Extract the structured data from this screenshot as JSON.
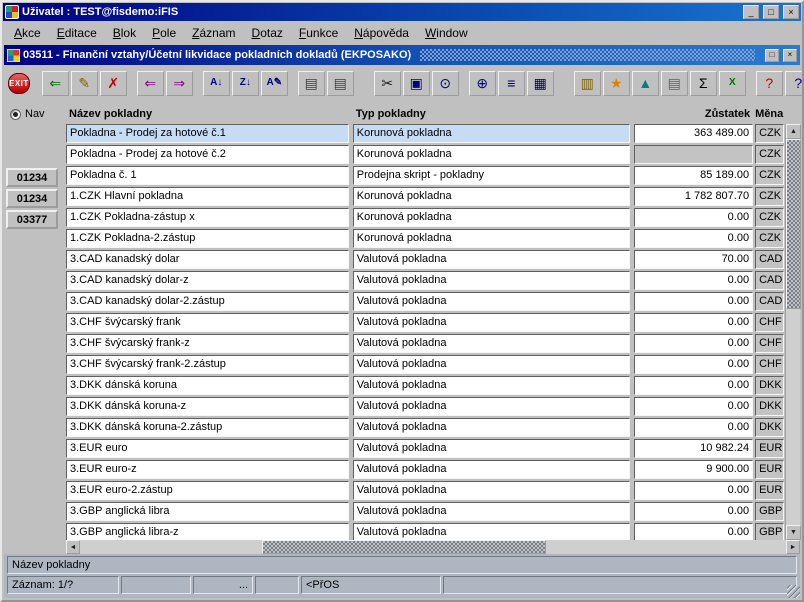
{
  "window": {
    "title": "Uživatel : TEST@fisdemo:iFIS",
    "buttons": {
      "minimize": "_",
      "maximize": "□",
      "close": "×"
    }
  },
  "menu": {
    "items": [
      "Akce",
      "Editace",
      "Blok",
      "Pole",
      "Záznam",
      "Dotaz",
      "Funkce",
      "Nápověda",
      "Window"
    ]
  },
  "mdi": {
    "title": "03511 - Finanční vztahy/Účetní likvidace pokladních dokladů (EKPOSAKO)",
    "buttons": {
      "restore": "□",
      "close": "×"
    }
  },
  "toolbar": {
    "exit_label": "EXIT",
    "icons": [
      {
        "name": "rollback-icon",
        "glyph": "⇐",
        "color": "#007000",
        "gap": ""
      },
      {
        "name": "edit-record-icon",
        "glyph": "✎",
        "color": "#806000",
        "gap": ""
      },
      {
        "name": "delete-record-icon",
        "glyph": "✗",
        "color": "#c00000",
        "gap": ""
      },
      {
        "name": "fetch-prev-icon",
        "glyph": "⇐",
        "color": "#800080",
        "gap": "gap"
      },
      {
        "name": "fetch-next-icon",
        "glyph": "⇒",
        "color": "#800080",
        "gap": ""
      },
      {
        "name": "sort-asc-icon",
        "glyph": "A↓",
        "color": "#000080",
        "gap": "gap",
        "small": true
      },
      {
        "name": "sort-desc-icon",
        "glyph": "Z↓",
        "color": "#000080",
        "gap": "",
        "small": true
      },
      {
        "name": "sort-edit-icon",
        "glyph": "A✎",
        "color": "#000080",
        "gap": "",
        "small": true
      },
      {
        "name": "print-icon",
        "glyph": "▤",
        "color": "#404040",
        "gap": "gap"
      },
      {
        "name": "print-all-icon",
        "glyph": "▤",
        "color": "#404040",
        "gap": ""
      },
      {
        "name": "cut-icon",
        "glyph": "✂",
        "color": "#202020",
        "gap": "biggap"
      },
      {
        "name": "copy-icon",
        "glyph": "▣",
        "color": "#000080",
        "gap": ""
      },
      {
        "name": "find-icon",
        "glyph": "⊙",
        "color": "#000080",
        "gap": ""
      },
      {
        "name": "zoom-icon",
        "glyph": "⊕",
        "color": "#000080",
        "gap": "gap"
      },
      {
        "name": "list-icon",
        "glyph": "≡",
        "color": "#000080",
        "gap": ""
      },
      {
        "name": "detail-list-icon",
        "glyph": "▦",
        "color": "#000080",
        "gap": ""
      },
      {
        "name": "clipboard-icon",
        "glyph": "▥",
        "color": "#806000",
        "gap": "biggap"
      },
      {
        "name": "favorites-icon",
        "glyph": "★",
        "color": "#e08000",
        "gap": ""
      },
      {
        "name": "chart-icon",
        "glyph": "▲",
        "color": "#008080",
        "gap": ""
      },
      {
        "name": "printer2-icon",
        "glyph": "▤",
        "color": "#606060",
        "gap": ""
      },
      {
        "name": "sum-icon",
        "glyph": "Σ",
        "color": "#000000",
        "gap": ""
      },
      {
        "name": "excel-icon",
        "glyph": "X",
        "color": "#007000",
        "gap": "",
        "small": true
      },
      {
        "name": "help-context-icon",
        "glyph": "?",
        "color": "#c00000",
        "gap": "gap"
      },
      {
        "name": "help-icon",
        "glyph": "?",
        "color": "#000080",
        "gap": ""
      }
    ]
  },
  "nav": {
    "label": "Nav",
    "buttons": [
      "01234",
      "01234",
      "03377"
    ]
  },
  "table": {
    "headers": {
      "name": "Název pokladny",
      "type": "Typ pokladny",
      "balance": "Zůstatek",
      "currency": "Měna"
    },
    "rows": [
      {
        "name": "Pokladna - Prodej za hotové č.1",
        "type": "Korunová pokladna",
        "balance": "363 489.00",
        "currency": "CZK",
        "selected": true
      },
      {
        "name": "Pokladna - Prodej za hotové č.2",
        "type": "Korunová pokladna",
        "balance": "",
        "currency": "CZK"
      },
      {
        "name": "Pokladna č. 1",
        "type": "Prodejna skript - pokladny",
        "balance": "85 189.00",
        "currency": "CZK"
      },
      {
        "name": "1.CZK Hlavní pokladna",
        "type": "Korunová pokladna",
        "balance": "1 782 807.70",
        "currency": "CZK"
      },
      {
        "name": "1.CZK Pokladna-zástup x",
        "type": "Korunová pokladna",
        "balance": "0.00",
        "currency": "CZK"
      },
      {
        "name": "1.CZK Pokladna-2.zástup",
        "type": "Korunová pokladna",
        "balance": "0.00",
        "currency": "CZK"
      },
      {
        "name": "3.CAD kanadský dolar",
        "type": "Valutová pokladna",
        "balance": "70.00",
        "currency": "CAD"
      },
      {
        "name": "3.CAD kanadský dolar-z",
        "type": "Valutová pokladna",
        "balance": "0.00",
        "currency": "CAD"
      },
      {
        "name": "3.CAD kanadský dolar-2.zástup",
        "type": "Valutová pokladna",
        "balance": "0.00",
        "currency": "CAD"
      },
      {
        "name": "3.CHF švýcarský frank",
        "type": "Valutová pokladna",
        "balance": "0.00",
        "currency": "CHF"
      },
      {
        "name": "3.CHF švýcarský frank-z",
        "type": "Valutová pokladna",
        "balance": "0.00",
        "currency": "CHF"
      },
      {
        "name": "3.CHF švýcarský frank-2.zástup",
        "type": "Valutová pokladna",
        "balance": "0.00",
        "currency": "CHF"
      },
      {
        "name": "3.DKK dánská koruna",
        "type": "Valutová pokladna",
        "balance": "0.00",
        "currency": "DKK"
      },
      {
        "name": "3.DKK dánská koruna-z",
        "type": "Valutová pokladna",
        "balance": "0.00",
        "currency": "DKK"
      },
      {
        "name": "3.DKK dánská koruna-2.zástup",
        "type": "Valutová pokladna",
        "balance": "0.00",
        "currency": "DKK"
      },
      {
        "name": "3.EUR euro",
        "type": "Valutová pokladna",
        "balance": "10 982.24",
        "currency": "EUR"
      },
      {
        "name": "3.EUR euro-z",
        "type": "Valutová pokladna",
        "balance": "9 900.00",
        "currency": "EUR"
      },
      {
        "name": "3.EUR euro-2.zástup",
        "type": "Valutová pokladna",
        "balance": "0.00",
        "currency": "EUR"
      },
      {
        "name": "3.GBP anglická libra",
        "type": "Valutová pokladna",
        "balance": "0.00",
        "currency": "GBP"
      },
      {
        "name": "3.GBP anglická libra-z",
        "type": "Valutová pokladna",
        "balance": "0.00",
        "currency": "GBP"
      }
    ]
  },
  "statusbar": {
    "hint": "Název pokladny",
    "record": "Záznam: 1/?",
    "dots": "...",
    "mode": "<PřOS"
  }
}
